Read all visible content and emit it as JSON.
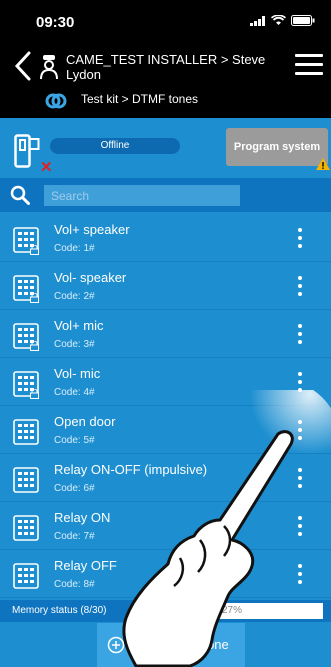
{
  "status_bar": {
    "time": "09:30"
  },
  "header": {
    "title": "CAME_TEST INSTALLER > Steve Lydon",
    "subtitle": "Test kit > DTMF tones"
  },
  "toolbar": {
    "status": "Offline",
    "program_button": "Program system"
  },
  "search": {
    "placeholder": "Search"
  },
  "tones": [
    {
      "name": "Vol+ speaker",
      "code": "Code: 1#"
    },
    {
      "name": "Vol- speaker",
      "code": "Code: 2#"
    },
    {
      "name": "Vol+ mic",
      "code": "Code: 3#"
    },
    {
      "name": "Vol- mic",
      "code": "Code: 4#"
    },
    {
      "name": "Open door",
      "code": "Code: 5#"
    },
    {
      "name": "Relay ON-OFF (impulsive)",
      "code": "Code: 6#"
    },
    {
      "name": "Relay ON",
      "code": "Code: 7#"
    },
    {
      "name": "Relay OFF",
      "code": "Code: 8#"
    }
  ],
  "memory": {
    "label": "Memory status (8/30)",
    "percent_text": "27%",
    "fraction": 0.27
  },
  "add_button": {
    "label": "Add DTMF tone"
  },
  "colors": {
    "list_bg": "#1d8fd0",
    "header_bg": "#000000",
    "accent": "#0f74c0",
    "warning": "#f5b400",
    "error": "#e32020"
  }
}
